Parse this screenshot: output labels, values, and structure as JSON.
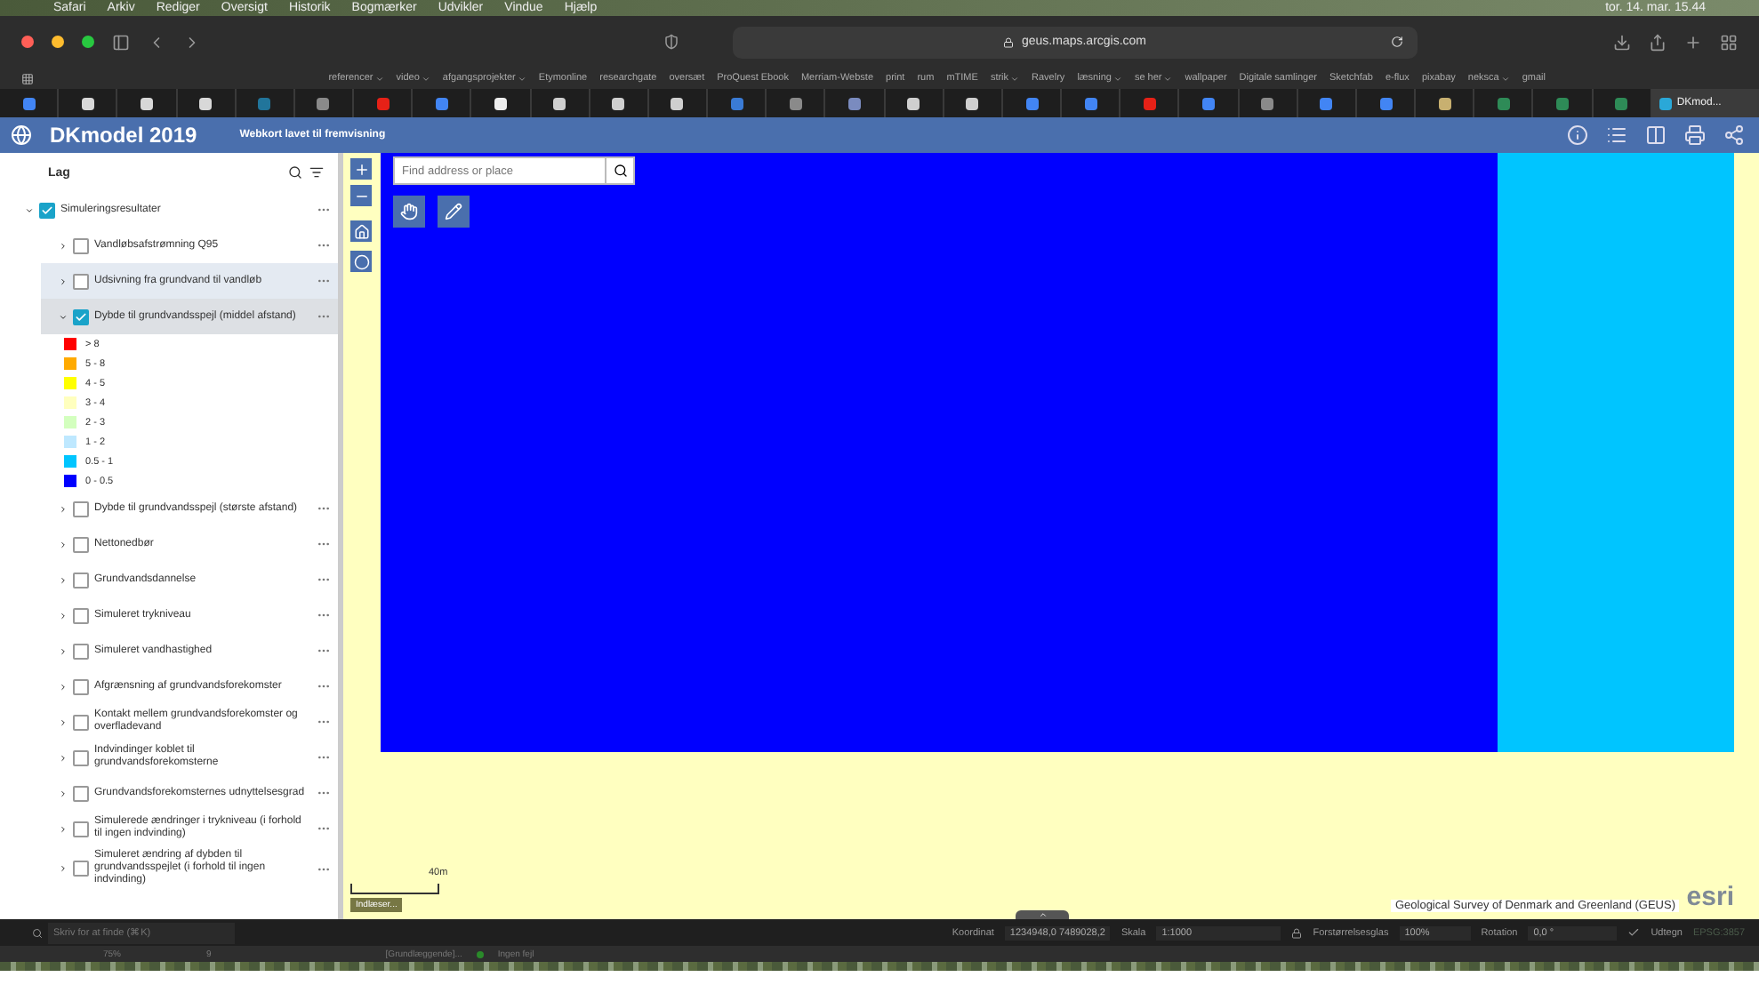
{
  "menubar": {
    "items": [
      "Safari",
      "Arkiv",
      "Rediger",
      "Oversigt",
      "Historik",
      "Bogmærker",
      "Udvikler",
      "Vindue",
      "Hjælp"
    ],
    "clock": "tor. 14. mar. 15.44"
  },
  "browser": {
    "url": "geus.maps.arcgis.com",
    "bookmarks": [
      {
        "label": "referencer",
        "folder": true
      },
      {
        "label": "video",
        "folder": true
      },
      {
        "label": "afgangsprojekter",
        "folder": true
      },
      {
        "label": "Etymonline",
        "folder": false
      },
      {
        "label": "researchgate",
        "folder": false
      },
      {
        "label": "oversæt",
        "folder": false
      },
      {
        "label": "ProQuest Ebook",
        "folder": false
      },
      {
        "label": "Merriam-Webste",
        "folder": false
      },
      {
        "label": "print",
        "folder": false
      },
      {
        "label": "rum",
        "folder": false
      },
      {
        "label": "mTIME",
        "folder": false
      },
      {
        "label": "strik",
        "folder": true
      },
      {
        "label": "Ravelry",
        "folder": false
      },
      {
        "label": "læsning",
        "folder": true
      },
      {
        "label": "se her",
        "folder": true
      },
      {
        "label": "wallpaper",
        "folder": false
      },
      {
        "label": "Digitale samlinger",
        "folder": false
      },
      {
        "label": "Sketchfab",
        "folder": false
      },
      {
        "label": "e-flux",
        "folder": false
      },
      {
        "label": "pixabay",
        "folder": false
      },
      {
        "label": "neksca",
        "folder": true
      },
      {
        "label": "gmail",
        "folder": false
      }
    ],
    "tabs": [
      {
        "color": "#4285f4",
        "selected": false
      },
      {
        "color": "#d8d8d8",
        "selected": false
      },
      {
        "color": "#d8d8d8",
        "selected": false
      },
      {
        "color": "#d8d8d8",
        "selected": false
      },
      {
        "color": "#21759b",
        "selected": false
      },
      {
        "color": "#8a8a8a",
        "selected": false
      },
      {
        "color": "#e62117",
        "selected": false
      },
      {
        "color": "#4285f4",
        "selected": false
      },
      {
        "color": "#eeeeee",
        "selected": false
      },
      {
        "color": "#cfcfcf",
        "selected": false
      },
      {
        "color": "#cfcfcf",
        "selected": false
      },
      {
        "color": "#cfcfcf",
        "selected": false
      },
      {
        "color": "#3a7bd5",
        "selected": false
      },
      {
        "color": "#8a8a8a",
        "selected": false
      },
      {
        "color": "#7a8bbf",
        "selected": false
      },
      {
        "color": "#cfcfcf",
        "selected": false
      },
      {
        "color": "#cfcfcf",
        "selected": false
      },
      {
        "color": "#4285f4",
        "selected": false
      },
      {
        "color": "#4285f4",
        "selected": false
      },
      {
        "color": "#e62117",
        "selected": false
      },
      {
        "color": "#4285f4",
        "selected": false
      },
      {
        "color": "#8a8a8a",
        "selected": false
      },
      {
        "color": "#4285f4",
        "selected": false
      },
      {
        "color": "#4285f4",
        "selected": false
      },
      {
        "color": "#c8b070",
        "selected": false
      },
      {
        "color": "#2e8b57",
        "selected": false
      },
      {
        "color": "#2e8b57",
        "selected": false
      },
      {
        "color": "#2e8b57",
        "selected": false
      },
      {
        "label": "DKmod...",
        "color": "#2aa8d8",
        "selected": true
      }
    ]
  },
  "app": {
    "title": "DKmodel 2019",
    "subtitle": "Webkort lavet til fremvisning"
  },
  "layers_panel": {
    "title": "Lag",
    "group": {
      "name": "Simuleringsresultater",
      "checked": true,
      "expanded": true,
      "children": [
        {
          "name": "Vandløbsafstrømning Q95",
          "checked": false,
          "expanded": false,
          "hovered": false,
          "selected": false
        },
        {
          "name": "Udsivning fra grundvand til vandløb",
          "checked": false,
          "expanded": false,
          "hovered": true,
          "selected": false
        },
        {
          "name": "Dybde til grundvandsspejl (middel afstand)",
          "checked": true,
          "expanded": true,
          "hovered": false,
          "selected": true,
          "legend": [
            {
              "label": "> 8",
              "color": "#ff0000"
            },
            {
              "label": "5 - 8",
              "color": "#ffaa00"
            },
            {
              "label": "4 - 5",
              "color": "#ffff00"
            },
            {
              "label": "3 - 4",
              "color": "#ffffbe"
            },
            {
              "label": "2 - 3",
              "color": "#d3ffbe"
            },
            {
              "label": "1 - 2",
              "color": "#bee8ff"
            },
            {
              "label": "0.5 - 1",
              "color": "#00c5ff"
            },
            {
              "label": "0 - 0.5",
              "color": "#0000ff"
            }
          ]
        },
        {
          "name": "Dybde til grundvandsspejl (største afstand)",
          "checked": false,
          "expanded": false,
          "hovered": false,
          "selected": false
        },
        {
          "name": "Nettonedbør",
          "checked": false,
          "expanded": false,
          "hovered": false,
          "selected": false
        },
        {
          "name": "Grundvandsdannelse",
          "checked": false,
          "expanded": false,
          "hovered": false,
          "selected": false
        },
        {
          "name": "Simuleret trykniveau",
          "checked": false,
          "expanded": false,
          "hovered": false,
          "selected": false
        },
        {
          "name": "Simuleret vandhastighed",
          "checked": false,
          "expanded": false,
          "hovered": false,
          "selected": false
        },
        {
          "name": "Afgrænsning af grundvandsforekomster",
          "checked": false,
          "expanded": false,
          "hovered": false,
          "selected": false
        },
        {
          "name": "Kontakt mellem grundvandsforekomster og overfladevand",
          "checked": false,
          "expanded": false,
          "hovered": false,
          "selected": false
        },
        {
          "name": "Indvindinger koblet til grundvandsforekomsterne",
          "checked": false,
          "expanded": false,
          "hovered": false,
          "selected": false
        },
        {
          "name": "Grundvandsforekomsternes udnyttelsesgrad",
          "checked": false,
          "expanded": false,
          "hovered": false,
          "selected": false
        },
        {
          "name": "Simulerede ændringer i trykniveau (i forhold til ingen indvinding)",
          "checked": false,
          "expanded": false,
          "hovered": false,
          "selected": false
        },
        {
          "name": "Simuleret ændring af dybden til grundvandsspejlet (i forhold til ingen indvinding)",
          "checked": false,
          "expanded": false,
          "hovered": false,
          "selected": false
        }
      ]
    }
  },
  "map": {
    "search": {
      "placeholder": "Find address or place"
    },
    "scale": "40m",
    "loading": "Indlæser...",
    "attribution": "Geological Survey of Denmark and Greenland (GEUS)",
    "logo": "esri"
  },
  "statusbar": {
    "search_placeholder": "Skriv for at finde (⌘K)",
    "coordinate_label": "Koordinat",
    "coordinate": "1234948,0 7489028,2",
    "scale_label": "Skala",
    "scale": "1:1000",
    "magnifier_label": "Forstørrelsesglas",
    "magnifier": "100%",
    "rotation_label": "Rotation",
    "rotation": "0,0 °",
    "render_label": "Udtegn",
    "render": true,
    "crs": "EPSG:3857"
  },
  "bottom_bar": {
    "zoom": "75%",
    "page": "9",
    "mode": "[Grundlæggende]...",
    "errors": "Ingen fejl"
  }
}
